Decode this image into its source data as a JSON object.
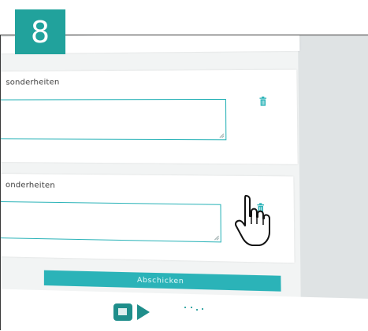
{
  "step_badge": "8",
  "form": {
    "field1_label": "sonderheiten",
    "field2_label": "onderheiten",
    "submit_label": "Abschicken"
  },
  "colors": {
    "accent": "#2bb3b8",
    "badge": "#21a29c"
  },
  "icons": {
    "delete": "trash-icon",
    "cursor": "hand-pointer-icon"
  }
}
